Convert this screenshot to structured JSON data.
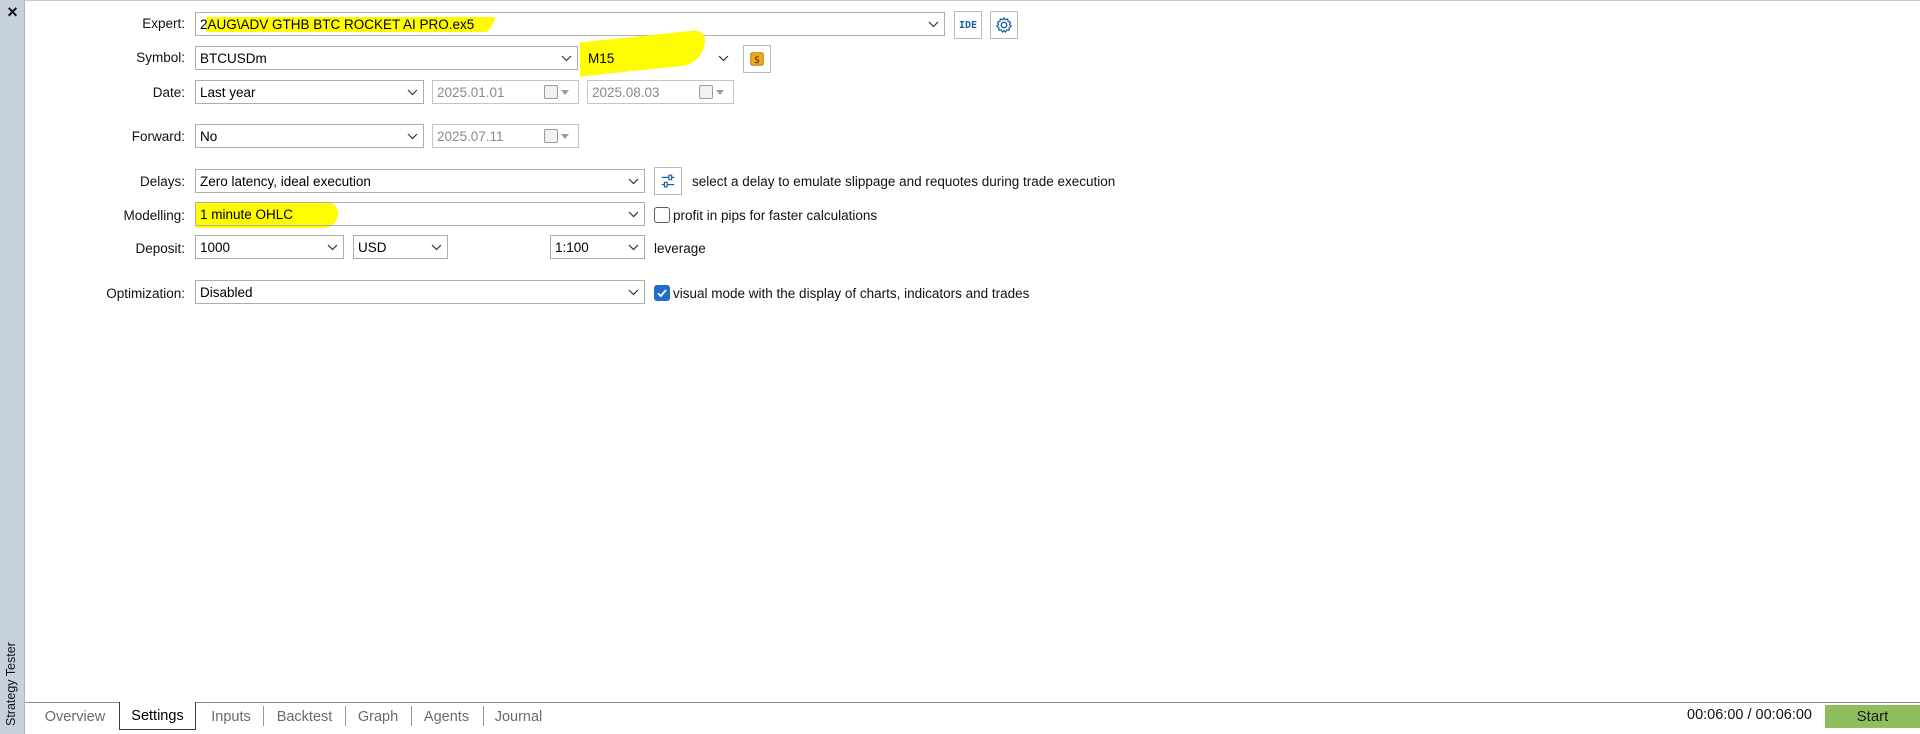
{
  "panel": {
    "title": "Strategy Tester",
    "close_symbol": "×"
  },
  "expert": {
    "label": "Expert:",
    "value": "2AUG\\ADV GTHB BTC ROCKET AI PRO.ex5",
    "ide_label": "IDE"
  },
  "symbol": {
    "label": "Symbol:",
    "value": "BTCUSDm",
    "timeframe": "M15"
  },
  "date": {
    "label": "Date:",
    "range": "Last year",
    "from": "2025.01.01",
    "to": "2025.08.03"
  },
  "forward": {
    "label": "Forward:",
    "value": "No",
    "date": "2025.07.11"
  },
  "delays": {
    "label": "Delays:",
    "value": "Zero latency, ideal execution",
    "hint": "select a delay to emulate slippage and requotes during trade execution"
  },
  "modelling": {
    "label": "Modelling:",
    "value": "1 minute OHLC",
    "checkbox_label": "profit in pips for faster calculations",
    "checkbox_checked": false
  },
  "deposit": {
    "label": "Deposit:",
    "amount": "1000",
    "currency": "USD",
    "leverage": "1:100",
    "leverage_label": "leverage"
  },
  "optimization": {
    "label": "Optimization:",
    "value": "Disabled",
    "checkbox_label": "visual mode with the display of charts, indicators and trades",
    "checkbox_checked": true
  },
  "tabs": [
    {
      "label": "Overview",
      "active": false
    },
    {
      "label": "Settings",
      "active": true
    },
    {
      "label": "Inputs",
      "active": false
    },
    {
      "label": "Backtest",
      "active": false
    },
    {
      "label": "Graph",
      "active": false
    },
    {
      "label": "Agents",
      "active": false
    },
    {
      "label": "Journal",
      "active": false
    }
  ],
  "status": {
    "timer": "00:06:00 / 00:06:00",
    "start_label": "Start"
  },
  "colors": {
    "highlight": "#fffb00",
    "accent": "#1f6fd1",
    "start": "#8fbf5c",
    "strip": "#c7d1de"
  },
  "icons": [
    "close-icon",
    "gear-icon",
    "dollar-icon",
    "sliders-icon",
    "calendar-icon",
    "chevron-down-icon",
    "checkmark-icon"
  ]
}
